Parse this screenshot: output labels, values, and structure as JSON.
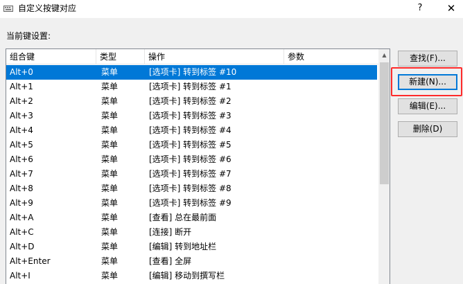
{
  "window": {
    "title": "自定义按键对应",
    "help_label": "?",
    "close_label": "✕"
  },
  "current_label": "当前键设置:",
  "columns": [
    "组合键",
    "类型",
    "操作",
    "参数"
  ],
  "rows": [
    {
      "key": "Alt+0",
      "type": "菜单",
      "action": "[选项卡] 转到标签 #10",
      "param": "",
      "selected": true
    },
    {
      "key": "Alt+1",
      "type": "菜单",
      "action": "[选项卡] 转到标签 #1",
      "param": ""
    },
    {
      "key": "Alt+2",
      "type": "菜单",
      "action": "[选项卡] 转到标签 #2",
      "param": ""
    },
    {
      "key": "Alt+3",
      "type": "菜单",
      "action": "[选项卡] 转到标签 #3",
      "param": ""
    },
    {
      "key": "Alt+4",
      "type": "菜单",
      "action": "[选项卡] 转到标签 #4",
      "param": ""
    },
    {
      "key": "Alt+5",
      "type": "菜单",
      "action": "[选项卡] 转到标签 #5",
      "param": ""
    },
    {
      "key": "Alt+6",
      "type": "菜单",
      "action": "[选项卡] 转到标签 #6",
      "param": ""
    },
    {
      "key": "Alt+7",
      "type": "菜单",
      "action": "[选项卡] 转到标签 #7",
      "param": ""
    },
    {
      "key": "Alt+8",
      "type": "菜单",
      "action": "[选项卡] 转到标签 #8",
      "param": ""
    },
    {
      "key": "Alt+9",
      "type": "菜单",
      "action": "[选项卡] 转到标签 #9",
      "param": ""
    },
    {
      "key": "Alt+A",
      "type": "菜单",
      "action": "[查看] 总在最前面",
      "param": ""
    },
    {
      "key": "Alt+C",
      "type": "菜单",
      "action": "[连接] 断开",
      "param": ""
    },
    {
      "key": "Alt+D",
      "type": "菜单",
      "action": "[编辑] 转到地址栏",
      "param": ""
    },
    {
      "key": "Alt+Enter",
      "type": "菜单",
      "action": "[查看] 全屏",
      "param": ""
    },
    {
      "key": "Alt+I",
      "type": "菜单",
      "action": "[编辑] 移动到撰写栏",
      "param": ""
    }
  ],
  "buttons": {
    "find": "查找(F)...",
    "new": "新建(N)...",
    "edit": "编辑(E)...",
    "delete": "删除(D)"
  },
  "colors": {
    "selection": "#0078d7",
    "highlight_box": "#ff2a2a"
  }
}
